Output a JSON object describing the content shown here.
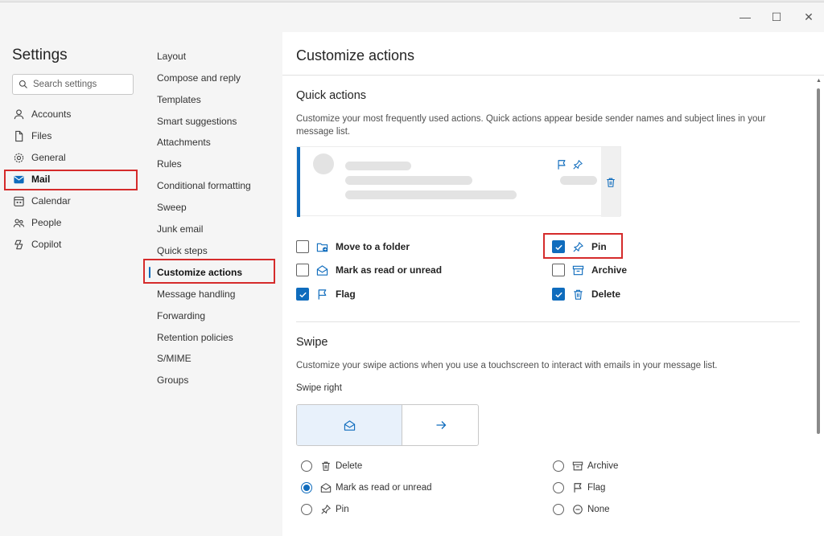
{
  "window": {
    "minimize_glyph": "—",
    "maximize_glyph": "☐",
    "close_glyph": "✕"
  },
  "nav": {
    "title": "Settings",
    "search_placeholder": "Search settings",
    "items": [
      {
        "label": "Accounts",
        "icon": "person-icon"
      },
      {
        "label": "Files",
        "icon": "file-icon"
      },
      {
        "label": "General",
        "icon": "gear-icon"
      },
      {
        "label": "Mail",
        "icon": "mail-icon",
        "active": true
      },
      {
        "label": "Calendar",
        "icon": "calendar-icon"
      },
      {
        "label": "People",
        "icon": "people-icon"
      },
      {
        "label": "Copilot",
        "icon": "copilot-icon"
      }
    ]
  },
  "subnav": {
    "items": [
      "Layout",
      "Compose and reply",
      "Templates",
      "Smart suggestions",
      "Attachments",
      "Rules",
      "Conditional formatting",
      "Sweep",
      "Junk email",
      "Quick steps",
      "Customize actions",
      "Message handling",
      "Forwarding",
      "Retention policies",
      "S/MIME",
      "Groups"
    ],
    "active": "Customize actions"
  },
  "main": {
    "title": "Customize actions",
    "quick_actions": {
      "heading": "Quick actions",
      "description": "Customize your most frequently used actions. Quick actions appear beside sender names and subject lines in your message list.",
      "options": [
        {
          "label": "Move to a folder",
          "checked": false,
          "icon": "folder-move-icon"
        },
        {
          "label": "Mark as read or unread",
          "checked": false,
          "icon": "envelope-open-icon"
        },
        {
          "label": "Flag",
          "checked": true,
          "icon": "flag-icon"
        },
        {
          "label": "Pin",
          "checked": true,
          "icon": "pin-icon"
        },
        {
          "label": "Archive",
          "checked": false,
          "icon": "archive-icon"
        },
        {
          "label": "Delete",
          "checked": true,
          "icon": "trash-icon"
        }
      ]
    },
    "swipe": {
      "heading": "Swipe",
      "description": "Customize your swipe actions when you use a touchscreen to interact with emails in your message list.",
      "swipe_right_label": "Swipe right",
      "options": [
        {
          "label": "Delete",
          "icon": "trash-icon",
          "selected": false
        },
        {
          "label": "Mark as read or unread",
          "icon": "envelope-open-icon",
          "selected": true
        },
        {
          "label": "Pin",
          "icon": "pin-icon",
          "selected": false
        },
        {
          "label": "Archive",
          "icon": "archive-icon",
          "selected": false
        },
        {
          "label": "Flag",
          "icon": "flag-icon",
          "selected": false
        },
        {
          "label": "None",
          "icon": "none-icon",
          "selected": false
        }
      ]
    }
  },
  "colors": {
    "accent": "#0f6cbd",
    "highlight": "#d52b2b"
  }
}
